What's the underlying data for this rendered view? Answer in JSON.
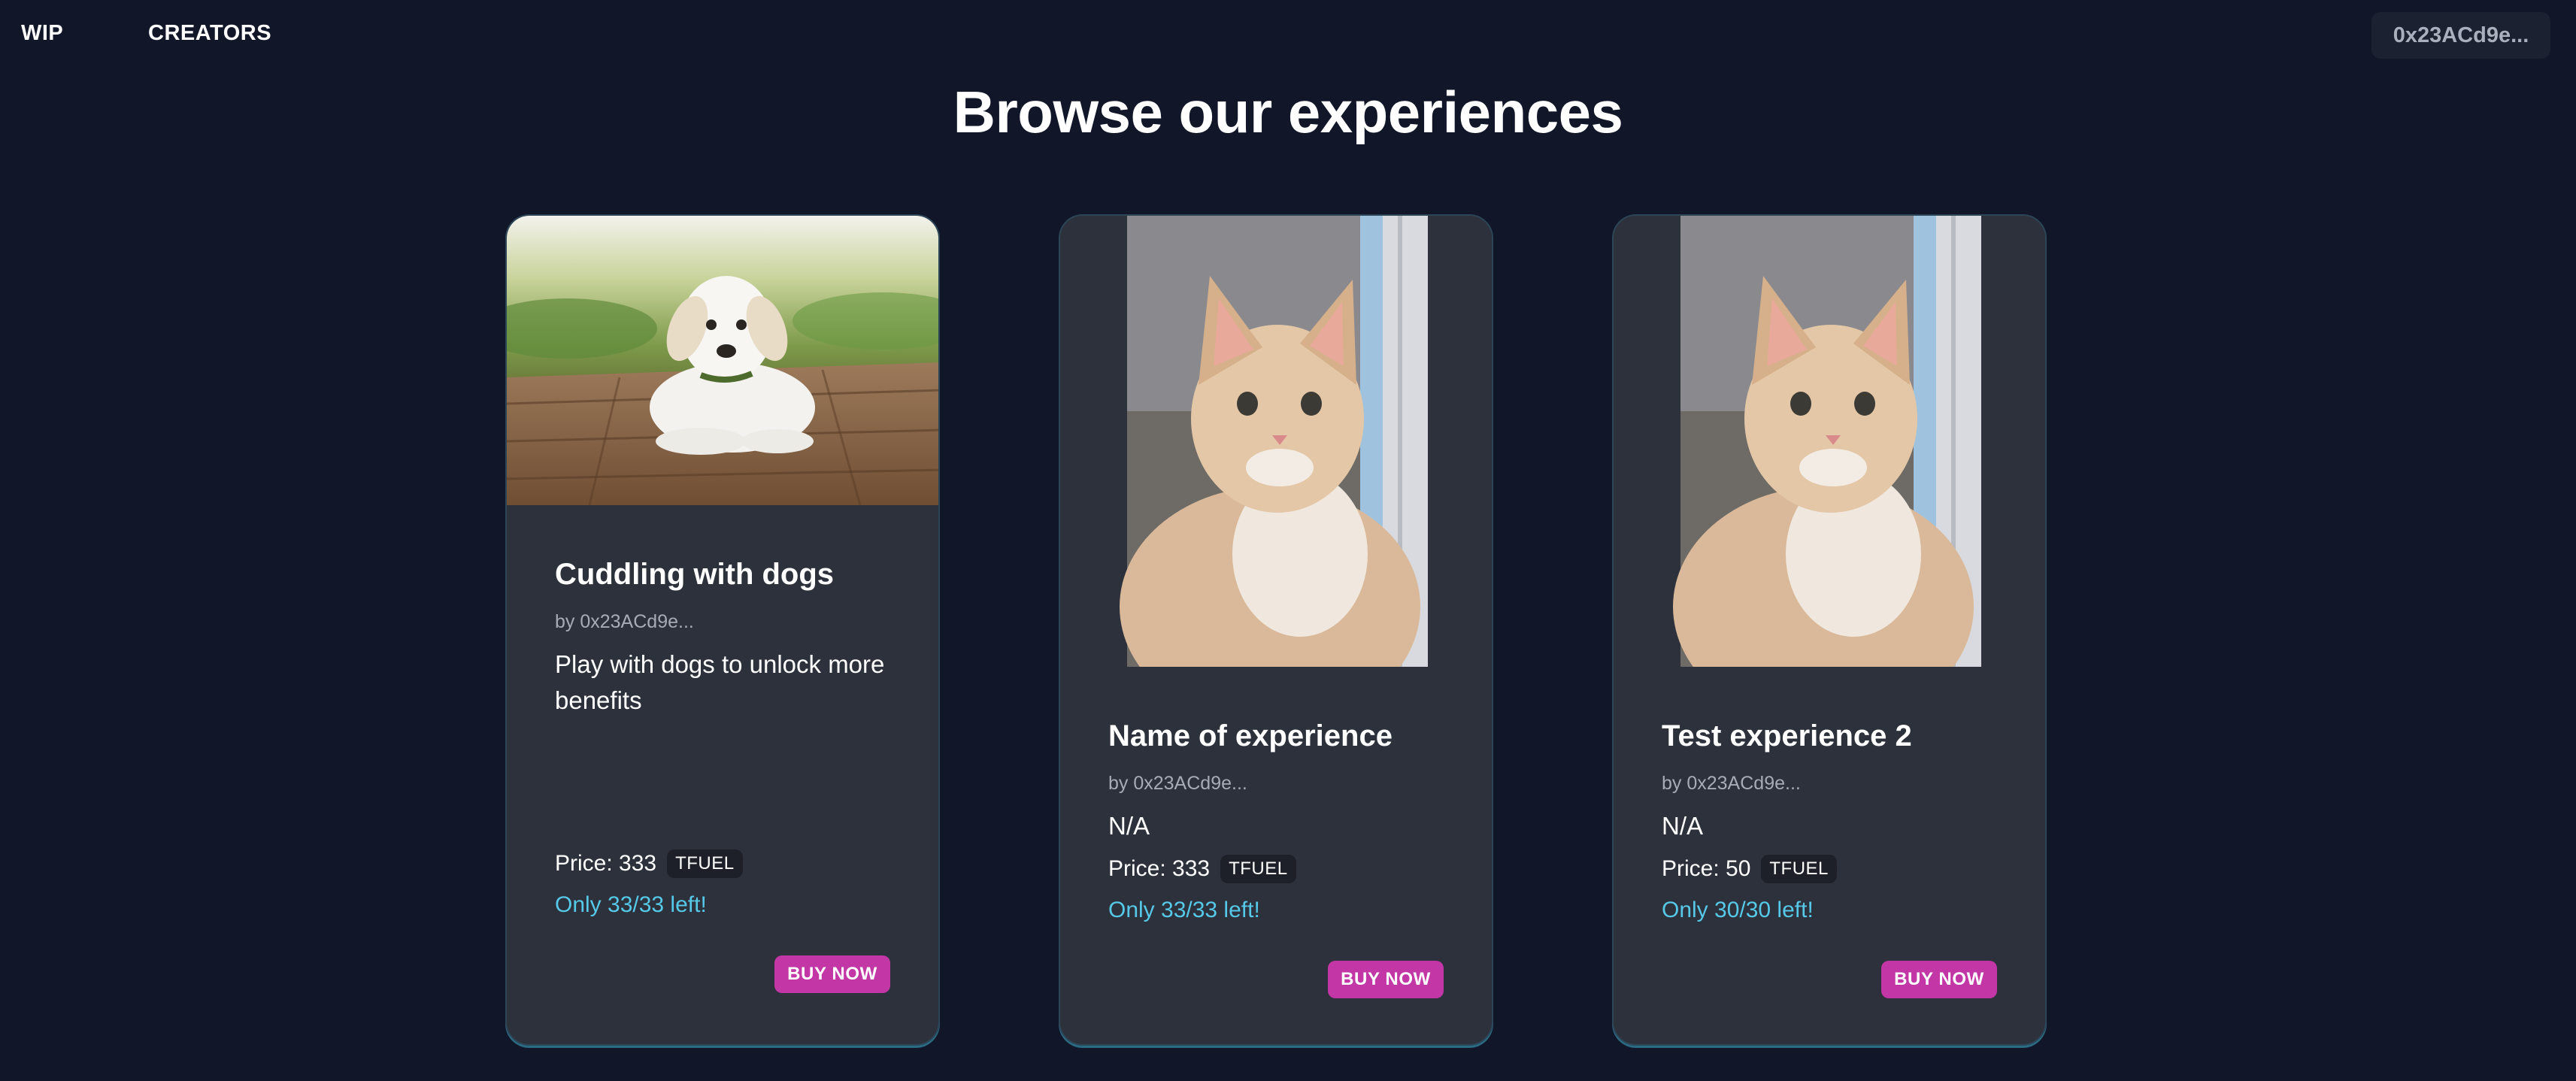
{
  "nav": {
    "links": [
      {
        "label": "WIP"
      },
      {
        "label": "CREATORS"
      }
    ],
    "wallet": "0x23ACd9e..."
  },
  "page": {
    "title": "Browse our experiences"
  },
  "experiences": [
    {
      "title": "Cuddling with dogs",
      "by": "by 0x23ACd9e...",
      "description": "Play with dogs to unlock more benefits",
      "price_label": "Price: 333",
      "currency": "TFUEL",
      "stock": "Only 33/33 left!",
      "button": "BUY NOW",
      "image": "puppy-photo"
    },
    {
      "title": "Name of experience",
      "by": "by 0x23ACd9e...",
      "description": "N/A",
      "price_label": "Price: 333",
      "currency": "TFUEL",
      "stock": "Only 33/33 left!",
      "button": "BUY NOW",
      "image": "kitten-photo"
    },
    {
      "title": "Test experience 2",
      "by": "by 0x23ACd9e...",
      "description": "N/A",
      "price_label": "Price: 50",
      "currency": "TFUEL",
      "stock": "Only 30/30 left!",
      "button": "BUY NOW",
      "image": "kitten-photo"
    }
  ],
  "colors": {
    "background": "#111628",
    "card": "#2d313c",
    "accent": "#c236a6",
    "stock_text": "#56c9e9"
  }
}
